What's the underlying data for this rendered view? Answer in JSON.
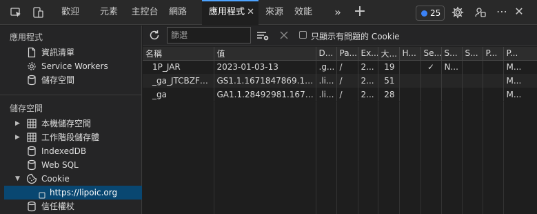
{
  "topbar": {
    "tabs": [
      {
        "label": "歡迎",
        "active": false
      },
      {
        "label": "元素",
        "active": false
      },
      {
        "label": "主控台",
        "active": false
      },
      {
        "label": "網路",
        "active": false
      },
      {
        "label": "應用程式",
        "active": true
      },
      {
        "label": "來源",
        "active": false
      },
      {
        "label": "效能",
        "active": false
      }
    ],
    "close_glyph": "✕",
    "more_glyph": "»",
    "add_glyph": "+",
    "issues_count": "25",
    "ellipsis_glyph": "⋯",
    "window_close_glyph": "✕"
  },
  "sidebar": {
    "app_title": "應用程式",
    "app_items": [
      {
        "label": "資訊清單",
        "icon": "document-icon"
      },
      {
        "label": "Service Workers",
        "icon": "gear-icon"
      },
      {
        "label": "儲存空間",
        "icon": "database-icon"
      }
    ],
    "storage_title": "儲存空間",
    "storage_items": [
      {
        "label": "本機儲存空間",
        "icon": "grid-icon",
        "expandable": true
      },
      {
        "label": "工作階段儲存體",
        "icon": "grid-icon",
        "expandable": true
      },
      {
        "label": "IndexedDB",
        "icon": "database-icon",
        "expandable": false
      },
      {
        "label": "Web SQL",
        "icon": "database-icon",
        "expandable": false
      },
      {
        "label": "Cookie",
        "icon": "cookie-icon",
        "expandable": true,
        "expanded": true
      }
    ],
    "cookie_origin": "https://lipoic.org",
    "trust_item": "信任權杖"
  },
  "toolbar": {
    "filter_placeholder": "篩選",
    "filter_value": "",
    "only_issues_label": "只顯示有問題的 Cookie",
    "only_issues_checked": false
  },
  "table": {
    "headers": [
      "名稱",
      "值",
      "D...",
      "Pa...",
      "Ex...",
      "大...",
      "H...",
      "Se...",
      "S...",
      "S...",
      "P...",
      "P..."
    ],
    "rows": [
      [
        "1P_JAR",
        "2023-01-03-13",
        ".g...",
        "/",
        "2...",
        "19",
        "",
        "✓",
        "N...",
        "",
        "",
        "M..."
      ],
      [
        "_ga_JTCBZF8K...",
        "GS1.1.1671847869.1.1.1...",
        ".li...",
        "/",
        "2...",
        "51",
        "",
        "",
        "",
        "",
        "",
        "M..."
      ],
      [
        "_ga",
        "GA1.1.28492981.167184...",
        ".li...",
        "/",
        "2...",
        "28",
        "",
        "",
        "",
        "",
        "",
        "M..."
      ]
    ]
  },
  "colors": {
    "accent": "#4da3ff",
    "selection": "#094771",
    "badge_dot": "#3b82f6"
  }
}
